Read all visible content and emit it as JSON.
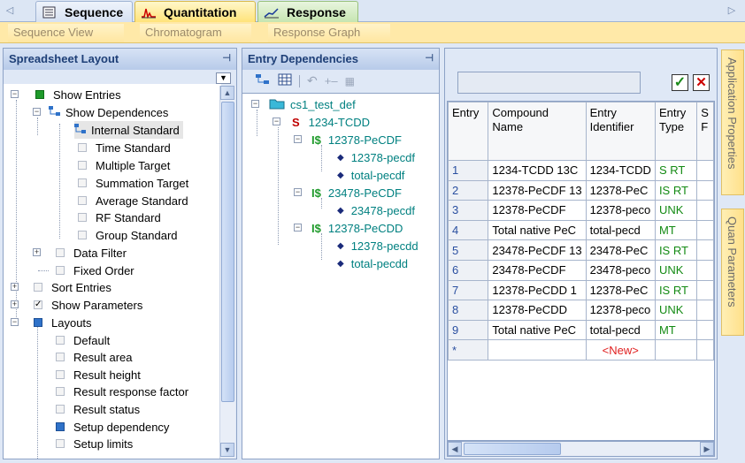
{
  "tabs": [
    "Sequence",
    "Quantitation",
    "Response"
  ],
  "subtabs": [
    "Sequence View",
    "Chromatogram",
    "Response Graph"
  ],
  "left_panel": {
    "title": "Spreadsheet Layout",
    "items": [
      "Show Entries",
      "Show Dependences",
      "Internal Standard",
      "Time Standard",
      "Multiple Target",
      "Summation Target",
      "Average Standard",
      "RF Standard",
      "Group Standard",
      "Data Filter",
      "Fixed Order",
      "Sort Entries",
      "Show Parameters",
      "Layouts",
      "Default",
      "Result area",
      "Result height",
      "Result response factor",
      "Result status",
      "Setup dependency",
      "Setup limits"
    ]
  },
  "mid_panel": {
    "title": "Entry Dependencies",
    "root": "cs1_test_def",
    "s_node": "1234-TCDD",
    "s_mark": "S",
    "is_mark": "I$",
    "groups": [
      {
        "name": "12378-PeCDF",
        "children": [
          "12378-pecdf",
          "total-pecdf"
        ]
      },
      {
        "name": "23478-PeCDF",
        "children": [
          "23478-pecdf"
        ]
      },
      {
        "name": "12378-PeCDD",
        "children": [
          "12378-pecdd",
          "total-pecdd"
        ]
      }
    ]
  },
  "grid": {
    "headers": [
      [
        "Entry"
      ],
      [
        "Compound",
        "Name"
      ],
      [
        "Entry",
        "Identifier"
      ],
      [
        "Entry",
        "Type"
      ],
      [
        "S",
        "F"
      ]
    ],
    "rows": [
      [
        "1",
        "1234-TCDD 13C",
        "1234-TCDD",
        "S RT"
      ],
      [
        "2",
        "12378-PeCDF 13",
        "12378-PeC",
        "IS RT"
      ],
      [
        "3",
        "12378-PeCDF",
        "12378-peco",
        "UNK"
      ],
      [
        "4",
        "Total native PeC",
        "total-pecd",
        "MT"
      ],
      [
        "5",
        "23478-PeCDF 13",
        "23478-PeC",
        "IS RT"
      ],
      [
        "6",
        "23478-PeCDF",
        "23478-peco",
        "UNK"
      ],
      [
        "7",
        "12378-PeCDD 1",
        "12378-PeC",
        "IS RT"
      ],
      [
        "8",
        "12378-PeCDD",
        "12378-peco",
        "UNK"
      ],
      [
        "9",
        "Total native PeC",
        "total-pecd",
        "MT"
      ]
    ],
    "new_marker": "*",
    "new_label": "<New>"
  },
  "side_tabs": [
    "Application Properties",
    "Quan Parameters"
  ]
}
